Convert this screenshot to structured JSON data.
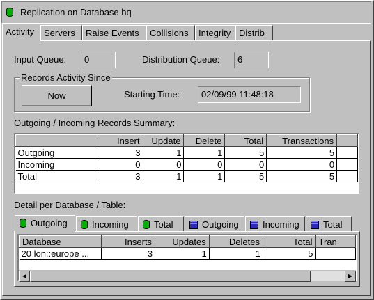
{
  "window": {
    "title": "Replication on Database hq"
  },
  "tabs": [
    "Activity",
    "Servers",
    "Raise Events",
    "Collisions",
    "Integrity",
    "Distrib"
  ],
  "queues": {
    "input_label": "Input Queue:",
    "input_value": "0",
    "distribution_label": "Distribution Queue:",
    "distribution_value": "6"
  },
  "records_activity": {
    "group_label": "Records Activity Since",
    "now_button": "Now",
    "starting_time_label": "Starting Time:",
    "starting_time_value": "02/09/99 11:48:18"
  },
  "summary": {
    "label": "Outgoing / Incoming Records Summary:",
    "columns": [
      "Insert",
      "Update",
      "Delete",
      "Total",
      "Transactions"
    ],
    "rows": [
      {
        "name": "Outgoing",
        "values": [
          "3",
          "1",
          "1",
          "5",
          "5"
        ]
      },
      {
        "name": "Incoming",
        "values": [
          "0",
          "0",
          "0",
          "0",
          "0"
        ]
      },
      {
        "name": "Total",
        "values": [
          "3",
          "1",
          "1",
          "5",
          "5"
        ]
      }
    ]
  },
  "detail": {
    "label": "Detail per Database / Table:",
    "tabs": [
      {
        "label": "Outgoing",
        "icon": "green-database-icon"
      },
      {
        "label": "Incoming",
        "icon": "green-database-icon"
      },
      {
        "label": "Total",
        "icon": "green-database-icon"
      },
      {
        "label": "Outgoing",
        "icon": "blue-table-icon"
      },
      {
        "label": "Incoming",
        "icon": "blue-table-icon"
      },
      {
        "label": "Total",
        "icon": "blue-table-icon"
      }
    ],
    "columns": [
      "Database",
      "Inserts",
      "Updates",
      "Deletes",
      "Total",
      "Tran"
    ],
    "rows": [
      {
        "values": [
          "20 lon::europe  ...",
          "3",
          "1",
          "1",
          "5",
          ""
        ]
      }
    ]
  },
  "colors": {
    "face": "#c0c0c0",
    "green": "#00b000",
    "blue": "#2b2bbf"
  }
}
